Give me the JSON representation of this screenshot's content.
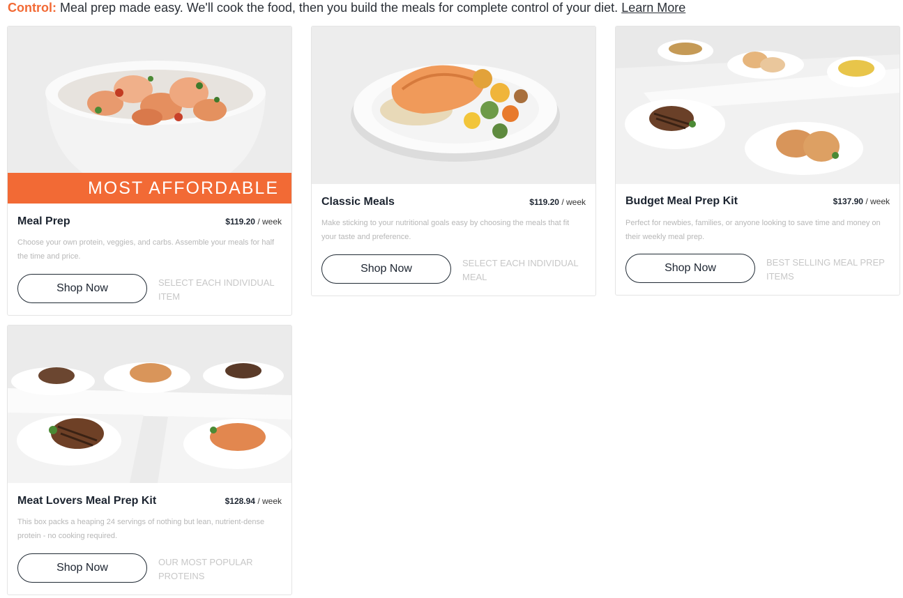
{
  "intro": {
    "lead": "Control:",
    "text": " Meal prep made easy. We'll cook the food, then you build the meals for complete control of your diet. ",
    "link": "Learn More"
  },
  "cards": [
    {
      "title": "Meal Prep",
      "price": "$119.20",
      "price_unit": " / week",
      "banner": "MOST AFFORDABLE",
      "description": "Choose your own protein, veggies, and carbs. Assemble your meals for half the time and price.",
      "button": "Shop Now",
      "tag": "SELECT EACH INDIVIDUAL ITEM"
    },
    {
      "title": "Classic Meals",
      "price": "$119.20",
      "price_unit": " / week",
      "description": "Make sticking to your nutritional goals easy by choosing the meals that fit your taste and preference.",
      "button": "Shop Now",
      "tag": "SELECT EACH INDIVIDUAL MEAL"
    },
    {
      "title": "Budget Meal Prep Kit",
      "price": "$137.90",
      "price_unit": " / week",
      "description": "Perfect for newbies, families, or anyone looking to save time and money on their weekly meal prep.",
      "button": "Shop Now",
      "tag": "BEST SELLING MEAL PREP ITEMS"
    },
    {
      "title": "Meat Lovers Meal Prep Kit",
      "price": "$128.94",
      "price_unit": " / week",
      "description": "This box packs a heaping 24 servings of nothing but lean, nutrient-dense protein - no cooking required.",
      "button": "Shop Now",
      "tag": "OUR MOST POPULAR PROTEINS"
    }
  ],
  "colors": {
    "accent": "#f26a35",
    "text": "#1c2430",
    "muted": "#b7b7b7"
  }
}
